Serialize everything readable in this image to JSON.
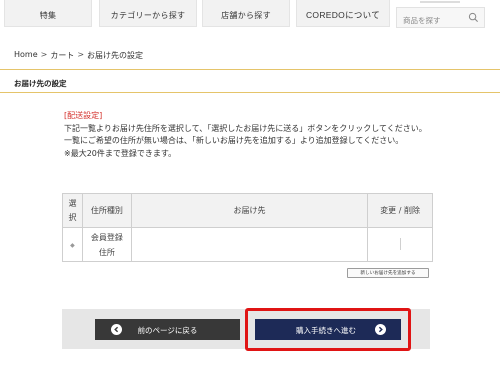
{
  "nav": {
    "items": [
      {
        "label": "特集"
      },
      {
        "label": "カテゴリーから探す"
      },
      {
        "label": "店舗から探す"
      },
      {
        "label": "COREDOについて"
      }
    ],
    "search_placeholder": "商品を探す"
  },
  "breadcrumb": {
    "home": "Home",
    "cart": "カート",
    "current": "お届け先の設定",
    "separator": ">"
  },
  "section": {
    "title": "お届け先の設定"
  },
  "instructions": {
    "heading": "[配送設定]",
    "line1": "下記一覧よりお届け先住所を選択して、「選択したお届け先に送る」ボタンをクリックしてください。",
    "line2": "一覧にご希望の住所が無い場合は、「新しいお届け先を追加する」より追加登録してください。",
    "line3": "※最大20件まで登録できます。"
  },
  "table": {
    "headers": {
      "select": "選択",
      "type": "住所種別",
      "destination": "お届け先",
      "edit": "変更 / 削除"
    },
    "rows": [
      {
        "select": "◆",
        "type": "会員登録住所",
        "destination": "",
        "edit": ""
      }
    ]
  },
  "add_address_button": "新しいお届け先を追加する",
  "buttons": {
    "back": "前のページに戻る",
    "next": "購入手続きへ進む"
  },
  "colors": {
    "accent_gold": "#e5c46a",
    "notice_red": "#d4302b",
    "next_navy": "#1d2a57",
    "back_dark": "#383838",
    "highlight_red": "#e01414"
  },
  "icons": {
    "search": "search-icon",
    "back": "chevron-left-circle-icon",
    "next": "chevron-right-circle-icon"
  }
}
